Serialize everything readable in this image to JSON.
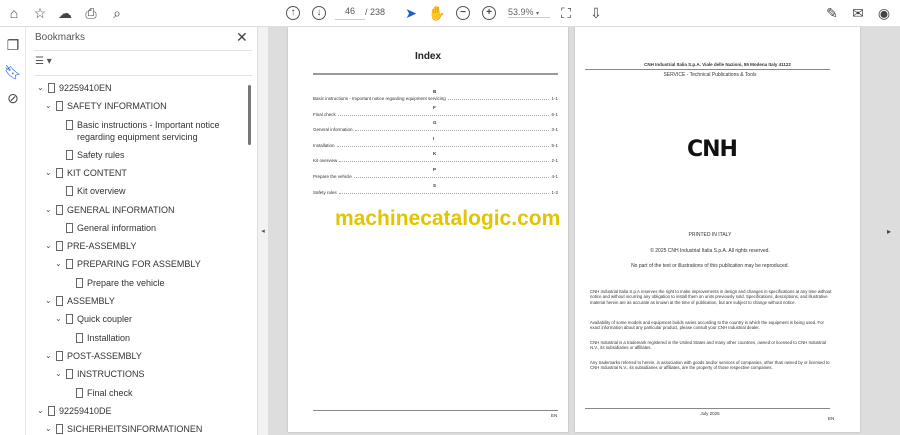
{
  "toolbar": {
    "page_current": "46",
    "page_total": "/ 238",
    "zoom": "53.9%"
  },
  "panel": {
    "title": "Bookmarks"
  },
  "tree": [
    {
      "label": "92259410EN",
      "level": 0,
      "exp": true
    },
    {
      "label": "SAFETY INFORMATION",
      "level": 1,
      "exp": true
    },
    {
      "label": "Basic instructions - Important notice",
      "label2": "regarding equipment servicing",
      "level": 2,
      "exp": false
    },
    {
      "label": "Safety rules",
      "level": 2,
      "exp": false
    },
    {
      "label": "KIT CONTENT",
      "level": 1,
      "exp": true
    },
    {
      "label": "Kit overview",
      "level": 2,
      "exp": false
    },
    {
      "label": "GENERAL INFORMATION",
      "level": 1,
      "exp": true
    },
    {
      "label": "General information",
      "level": 2,
      "exp": false
    },
    {
      "label": "PRE-ASSEMBLY",
      "level": 1,
      "exp": true
    },
    {
      "label": "PREPARING FOR ASSEMBLY",
      "level": 2,
      "exp": true
    },
    {
      "label": "Prepare the vehicle",
      "level": 3,
      "exp": false
    },
    {
      "label": "ASSEMBLY",
      "level": 1,
      "exp": true
    },
    {
      "label": "Quick coupler",
      "level": 2,
      "exp": true
    },
    {
      "label": "Installation",
      "level": 3,
      "exp": false
    },
    {
      "label": "POST-ASSEMBLY",
      "level": 1,
      "exp": true
    },
    {
      "label": "INSTRUCTIONS",
      "level": 2,
      "exp": true
    },
    {
      "label": "Final check",
      "level": 3,
      "exp": false
    },
    {
      "label": "92259410DE",
      "level": 0,
      "exp": true
    },
    {
      "label": "SICHERHEITSINFORMATIONEN",
      "level": 1,
      "exp": true
    }
  ],
  "index_page": {
    "title": "Index",
    "entries": [
      {
        "letter": "B",
        "text": "Basic instructions - Important notice regarding equipment servicing",
        "page": "1-1"
      },
      {
        "letter": "F",
        "text": "Final check",
        "page": "6-1"
      },
      {
        "letter": "G",
        "text": "General information",
        "page": "3-1"
      },
      {
        "letter": "I",
        "text": "Installation",
        "page": "5-1"
      },
      {
        "letter": "K",
        "text": "Kit overview",
        "page": "2-1"
      },
      {
        "letter": "P",
        "text": "Prepare the vehicle",
        "page": "4-1"
      },
      {
        "letter": "S",
        "text": "Safety rules",
        "page": "1-2"
      }
    ],
    "footer_lang": "EN"
  },
  "cover_page": {
    "header": "CNH Industrial Italia S.p.A. Viale delle Nazioni, 55 Modena Italy 41122",
    "subheader": "SERVICE - Technical Publications & Tools",
    "logo": "CNH",
    "printed": "PRINTED IN ITALY",
    "copyright": "© 2025 CNH Industrial Italia S.p.A. All rights reserved.",
    "no_part": "No part of the text or illustrations of this publication may be reproduced.",
    "paragraphs": [
      "CNH Industrial Italia S.p.A reserves the right to make improvements in design and changes in specifications at any time without notice and without incurring any obligation to install them on units previously sold. Specifications, descriptions, and illustrative material herein are as accurate as known at the time of publication, but are subject to change without notice.",
      "Availability of some models and equipment builds varies according to the country in which the equipment is being used. For exact information about any particular product, please consult your CNH Industrial dealer.",
      "CNH Industrial is a trademark registered in the United States and many other countries, owned or licensed to CNH Industrial N.V., its subsidiaries or affiliates.",
      "Any trademarks referred to herein, in association with goods and/or services of companies, other than owned by or licensed to CNH Industrial N.V., its subsidiaries or affiliates, are the property of those respective companies."
    ],
    "date": "July 2025",
    "footer_lang": "EN"
  },
  "watermark": "machinecatalogic.com"
}
